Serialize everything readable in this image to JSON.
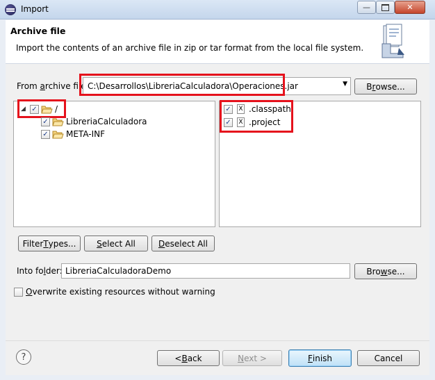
{
  "window": {
    "title": "Import"
  },
  "header": {
    "title": "Archive file",
    "description": "Import the contents of an archive file in zip or tar format from the local file system."
  },
  "archive": {
    "label_pre": "From ",
    "label_u": "a",
    "label_post": "rchive file:",
    "value": "C:\\Desarrollos\\LibreriaCalculadora\\Operaciones.jar",
    "browse_pre": "B",
    "browse_u": "r",
    "browse_post": "owse..."
  },
  "tree": {
    "root_label": "/",
    "items": [
      "LibreriaCalculadora",
      "META-INF"
    ]
  },
  "files": [
    ".classpath",
    ".project"
  ],
  "buttons": {
    "filter_pre": "Filter ",
    "filter_u": "T",
    "filter_post": "ypes...",
    "select_all_u": "S",
    "select_all_post": "elect All",
    "deselect_all_u": "D",
    "deselect_all_post": "eselect All"
  },
  "into": {
    "label_pre": "Into fo",
    "label_u": "l",
    "label_post": "der:",
    "value": "LibreriaCalculadoraDemo",
    "browse_pre": "Bro",
    "browse_u": "w",
    "browse_post": "se..."
  },
  "overwrite": {
    "u": "O",
    "post": "verwrite existing resources without warning",
    "checked": false
  },
  "footer": {
    "help": "?",
    "back_pre": "< ",
    "back_u": "B",
    "back_post": "ack",
    "next_u": "N",
    "next_post": "ext >",
    "finish_u": "F",
    "finish_post": "inish",
    "cancel": "Cancel"
  },
  "colors": {
    "highlight": "#e5121c",
    "checkmark": "#1f3e8a"
  }
}
